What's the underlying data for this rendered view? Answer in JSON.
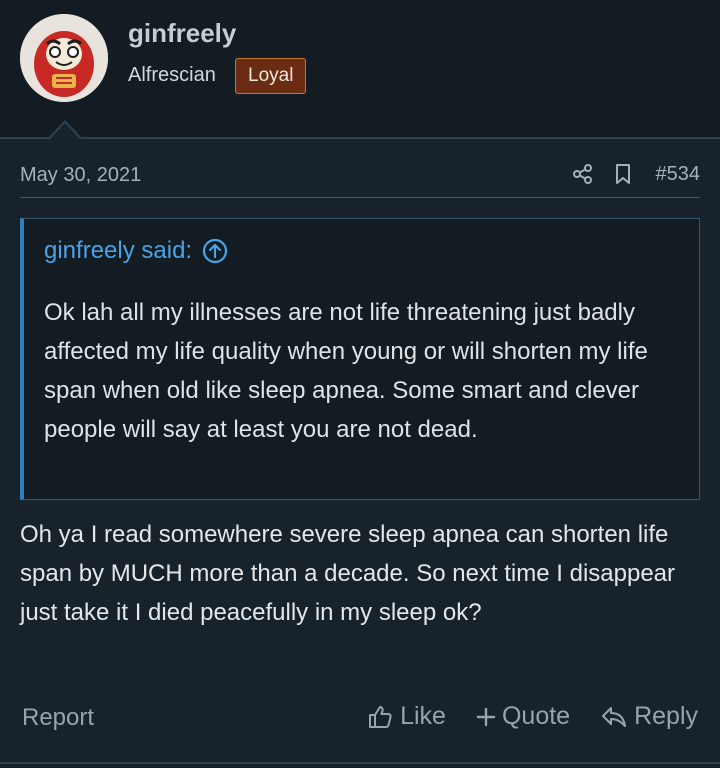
{
  "user": {
    "name": "ginfreely",
    "title": "Alfrescian",
    "badge": "Loyal"
  },
  "post": {
    "date": "May 30, 2021",
    "number": "#534",
    "quote": {
      "author": "ginfreely said:",
      "text": "Ok lah all my illnesses are not life threatening just badly affected my life quality when young or will shorten my life span when old like sleep apnea. Some smart and clever people will say at least you are not dead."
    },
    "body": "Oh ya I read somewhere severe sleep apnea can shorten life span by MUCH more than a decade. So next time I disappear just take it I died peacefully in my sleep ok?"
  },
  "footer": {
    "report": "Report",
    "like": "Like",
    "quote": "Quote",
    "reply": "Reply"
  },
  "icons": [
    "share-icon",
    "bookmark-icon",
    "arrow-up-circle-icon",
    "thumbs-up-icon",
    "plus-icon",
    "reply-icon"
  ],
  "colors": {
    "background": "#18222a",
    "header": "#131c22",
    "accent": "#4ba2e8",
    "badge_bg": "#6a2c12",
    "badge_border": "#c9762f"
  }
}
